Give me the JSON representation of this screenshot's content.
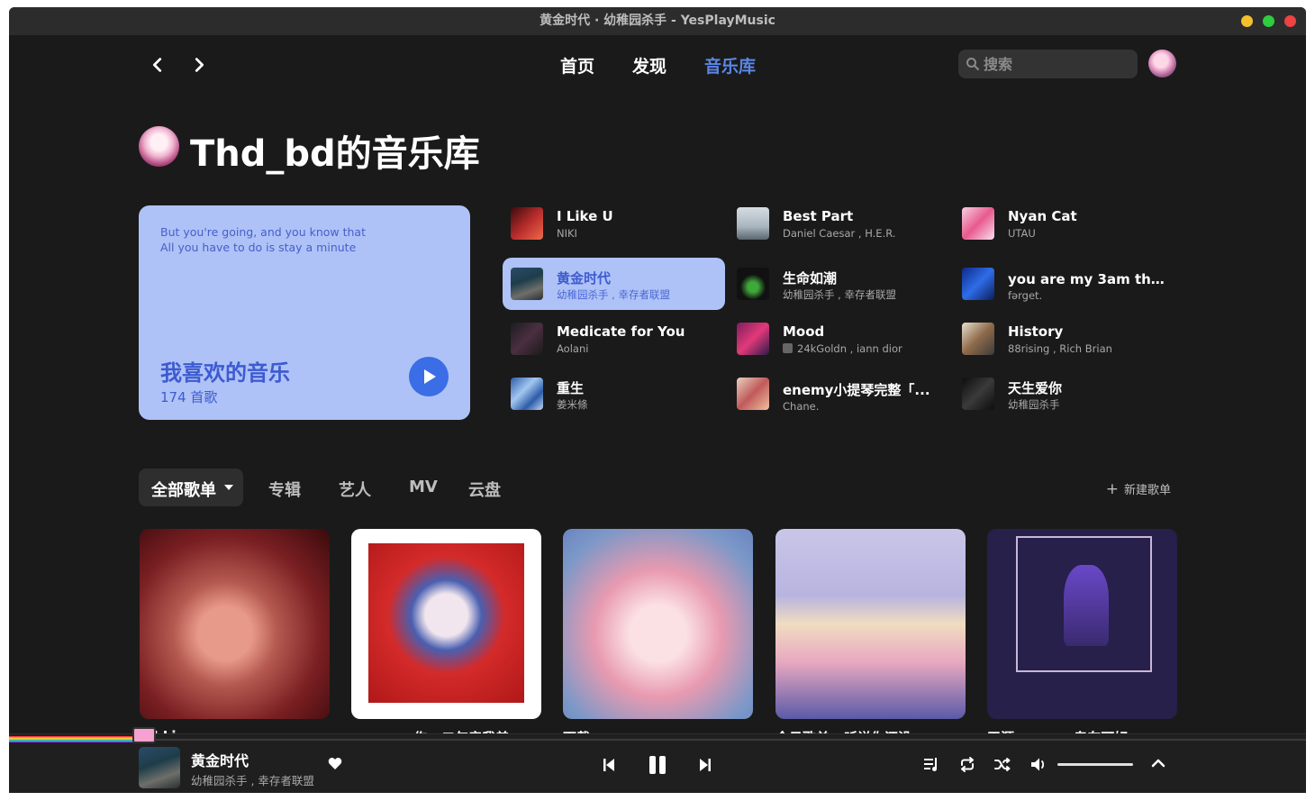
{
  "window": {
    "title": "黄金时代 · 幼稚园杀手 - YesPlayMusic"
  },
  "nav": {
    "tabs": [
      {
        "label": "首页"
      },
      {
        "label": "发现"
      },
      {
        "label": "音乐库"
      }
    ],
    "search_placeholder": "搜索"
  },
  "library": {
    "title": "Thd_bd的音乐库"
  },
  "liked": {
    "lyric_line1": "But you're going, and you know that",
    "lyric_line2": "All you have to do is stay a minute",
    "title": "我喜欢的音乐",
    "count": "174 首歌"
  },
  "tracks": [
    {
      "name": "I Like U",
      "artist": "NIKI"
    },
    {
      "name": "Best Part",
      "artist": "Daniel Caesar , H.E.R."
    },
    {
      "name": "Nyan Cat",
      "artist": "UTAU"
    },
    {
      "name": "黄金时代",
      "artist": "幼稚园杀手 , 幸存者联盟"
    },
    {
      "name": "生命如潮",
      "artist": "幼稚园杀手 , 幸存者联盟"
    },
    {
      "name": "you are my 3am thou...",
      "artist": "fərget."
    },
    {
      "name": "Medicate for You",
      "artist": "Aolani"
    },
    {
      "name": "Mood",
      "artist": "24kGoldn , iann dior"
    },
    {
      "name": "History",
      "artist": "88rising , Rich Brian"
    },
    {
      "name": "重生",
      "artist": "姜米條"
    },
    {
      "name": "enemy小提琴完整「...",
      "artist": "Chane."
    },
    {
      "name": "天生爱你",
      "artist": "幼稚园杀手"
    }
  ],
  "library_tabs": {
    "items": [
      "全部歌单",
      "专辑",
      "艺人",
      "MV",
      "云盘"
    ],
    "new_playlist": "新建歌单"
  },
  "albums": [
    {
      "caption": "I Li..."
    },
    {
      "caption": "...作 · 二年音我差"
    },
    {
      "caption": "下载"
    },
    {
      "caption": "今日歌单 · 听说你还没..."
    },
    {
      "caption": "天涯 · 一一一 专车可好"
    }
  ],
  "player": {
    "track_name": "黄金时代",
    "track_artist": "幼稚园杀手 , 幸存者联盟",
    "volume": 1.0
  },
  "colors": {
    "accent": "#5b86e5",
    "liked_card": "#aec2f7",
    "background": "#1a1a1a"
  }
}
